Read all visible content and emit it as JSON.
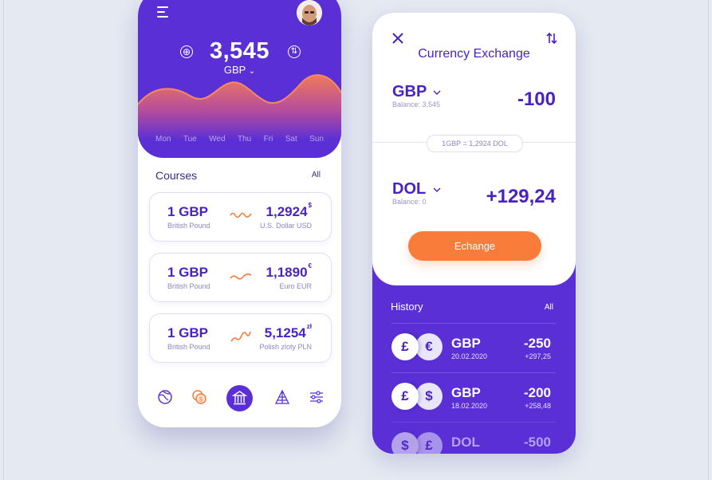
{
  "dashboard": {
    "balance": "3,545",
    "currency": "GBP",
    "currency_chevron": "⌄",
    "add_icon": "⊕",
    "swap_icon": "⇅",
    "days": [
      "Mon",
      "Tue",
      "Wed",
      "Thu",
      "Fri",
      "Sat",
      "Sun"
    ],
    "courses_title": "Courses",
    "courses_all": "All",
    "courses": [
      {
        "amount": "1 GBP",
        "name": "British Pound",
        "value": "1,2924",
        "symbol": "$",
        "sub": "U.S. Dollar USD"
      },
      {
        "amount": "1 GBP",
        "name": "British Pound",
        "value": "1,1890",
        "symbol": "€",
        "sub": "Euro EUR"
      },
      {
        "amount": "1 GBP",
        "name": "British Pound",
        "value": "5,1254",
        "symbol": "zł",
        "sub": "Polish zloty PLN"
      }
    ],
    "nav": [
      "globe-icon",
      "coins-icon",
      "bank-icon",
      "pyramid-icon",
      "sliders-icon"
    ]
  },
  "exchange": {
    "title": "Currency Exchange",
    "from": {
      "code": "GBP",
      "balance": "Balance: 3,545",
      "amount": "-100"
    },
    "rate": "1GBP = 1,2924 DOL",
    "to": {
      "code": "DOL",
      "balance": "Balance: 0",
      "amount": "+129,24"
    },
    "button": "Echange",
    "history_title": "History",
    "history_all": "All",
    "history": [
      {
        "coin1": "£",
        "coin2": "€",
        "code": "GBP",
        "date": "20.02.2020",
        "amount": "-250",
        "sub": "+297,25"
      },
      {
        "coin1": "£",
        "coin2": "$",
        "code": "GBP",
        "date": "18.02.2020",
        "amount": "-200",
        "sub": "+258,48"
      },
      {
        "coin1": "$",
        "coin2": "£",
        "code": "DOL",
        "date": "",
        "amount": "-500",
        "sub": ""
      }
    ]
  },
  "colors": {
    "primary": "#5a2fd6",
    "accent": "#fa7c3a",
    "background": "#e4e9f2"
  }
}
